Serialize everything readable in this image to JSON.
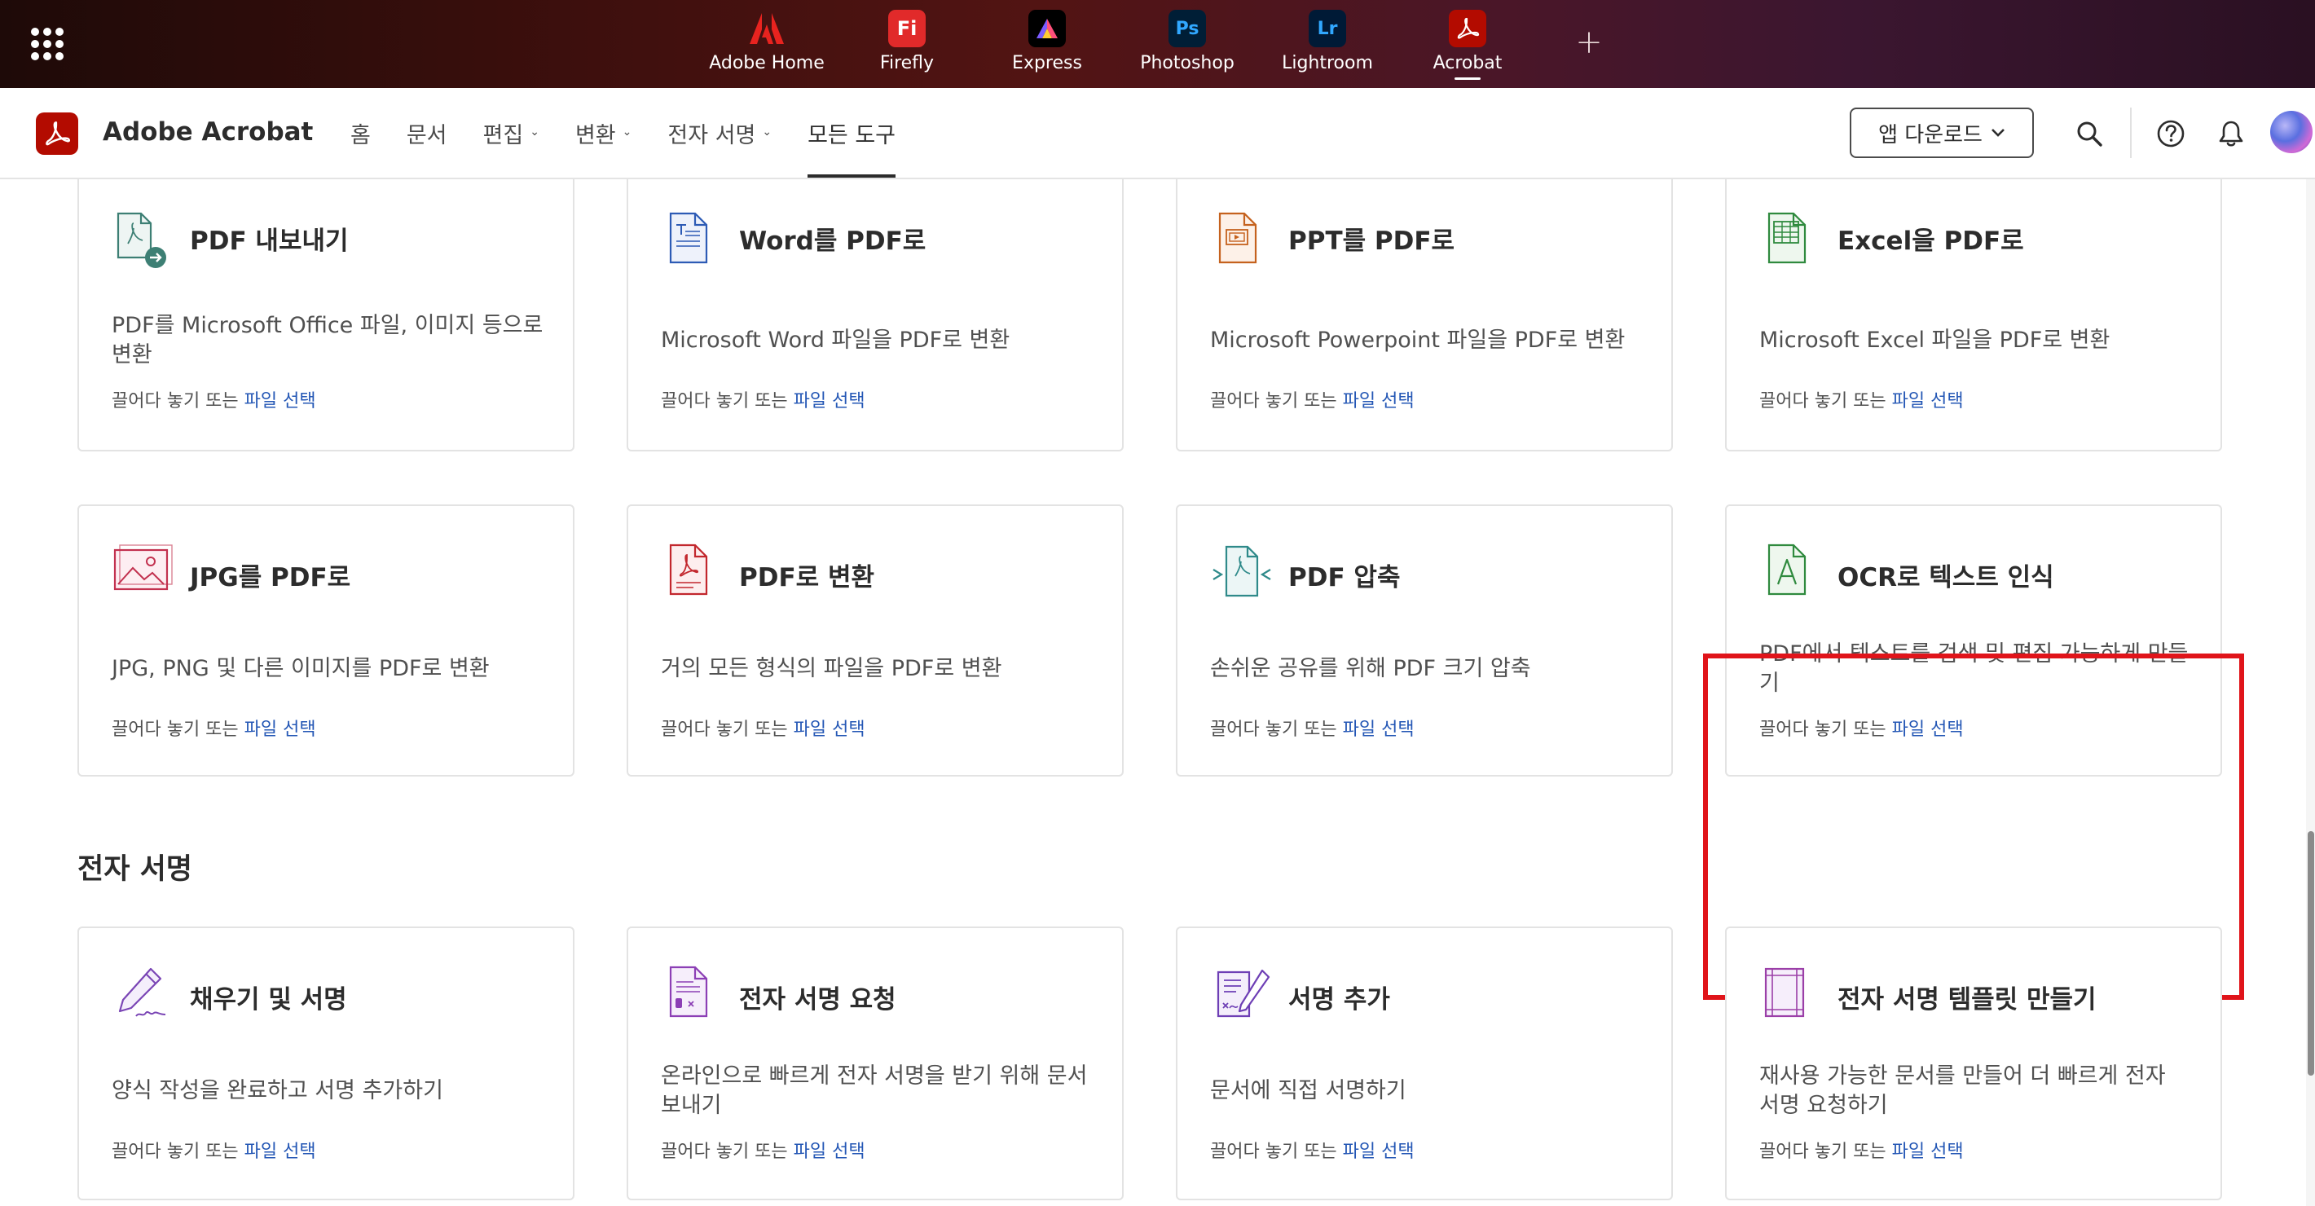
{
  "appbar": {
    "apps": [
      {
        "label": "Adobe Home",
        "icon": "adobe-logo-icon",
        "glyph": "A",
        "bg": "transparent",
        "fg": "#e8231f"
      },
      {
        "label": "Firefly",
        "icon": "firefly-icon",
        "glyph": "Fi",
        "bg": "#e12a2a",
        "fg": "#ffffff"
      },
      {
        "label": "Express",
        "icon": "express-icon",
        "glyph": "A",
        "bg": "#000000",
        "fg": "#ffffff"
      },
      {
        "label": "Photoshop",
        "icon": "photoshop-icon",
        "glyph": "Ps",
        "bg": "#001e36",
        "fg": "#31a8ff"
      },
      {
        "label": "Lightroom",
        "icon": "lightroom-icon",
        "glyph": "Lr",
        "bg": "#001a36",
        "fg": "#31a8ff"
      },
      {
        "label": "Acrobat",
        "icon": "acrobat-icon",
        "glyph": "",
        "bg": "#b30b00",
        "fg": "#ffffff"
      }
    ],
    "plus": "+"
  },
  "nav": {
    "brand": "Adobe Acrobat",
    "menu": [
      {
        "label": "홈",
        "has_dropdown": false,
        "active": false
      },
      {
        "label": "문서",
        "has_dropdown": false,
        "active": false
      },
      {
        "label": "편집",
        "has_dropdown": true,
        "active": false
      },
      {
        "label": "변환",
        "has_dropdown": true,
        "active": false
      },
      {
        "label": "전자 서명",
        "has_dropdown": true,
        "active": false
      },
      {
        "label": "모든 도구",
        "has_dropdown": false,
        "active": true
      }
    ],
    "download_label": "앱 다운로드"
  },
  "drop_text": "끌어다 놓기 또는",
  "drop_link": "파일 선택",
  "convert_tools": [
    {
      "title": "PDF 내보내기",
      "desc": "PDF를 Microsoft Office 파일, 이미지 등으로 변환",
      "icon": "pdf-export-icon"
    },
    {
      "title": "Word를 PDF로",
      "desc": "Microsoft Word 파일을 PDF로 변환",
      "icon": "word-to-pdf-icon"
    },
    {
      "title": "PPT를 PDF로",
      "desc": "Microsoft Powerpoint 파일을 PDF로 변환",
      "icon": "ppt-to-pdf-icon"
    },
    {
      "title": "Excel을 PDF로",
      "desc": "Microsoft Excel 파일을 PDF로 변환",
      "icon": "excel-to-pdf-icon"
    },
    {
      "title": "JPG를 PDF로",
      "desc": "JPG, PNG 및 다른 이미지를 PDF로 변환",
      "icon": "jpg-to-pdf-icon"
    },
    {
      "title": "PDF로 변환",
      "desc": "거의 모든 형식의 파일을 PDF로 변환",
      "icon": "create-pdf-icon"
    },
    {
      "title": "PDF 압축",
      "desc": "손쉬운 공유를 위해 PDF 크기 압축",
      "icon": "compress-pdf-icon"
    },
    {
      "title": "OCR로 텍스트 인식",
      "desc": "PDF에서 텍스트를 검색 및 편집 가능하게 만들기",
      "icon": "ocr-icon"
    }
  ],
  "esign_section": {
    "title": "전자 서명",
    "tools": [
      {
        "title": "채우기 및 서명",
        "desc": "양식 작성을 완료하고 서명 추가하기",
        "icon": "fill-sign-icon"
      },
      {
        "title": "전자 서명 요청",
        "desc": "온라인으로 빠르게 전자 서명을 받기 위해 문서 보내기",
        "icon": "request-esign-icon"
      },
      {
        "title": "서명 추가",
        "desc": "문서에 직접 서명하기",
        "icon": "add-signature-icon"
      },
      {
        "title": "전자 서명 템플릿 만들기",
        "desc": "재사용 가능한 문서를 만들어 더 빠르게 전자 서명 요청하기",
        "icon": "esign-template-icon"
      }
    ]
  },
  "colors": {
    "acrobat_red": "#b30b00",
    "link_blue": "#2457b5",
    "highlight_red": "#e0141a",
    "esign_purple": "#8c4bbf"
  }
}
